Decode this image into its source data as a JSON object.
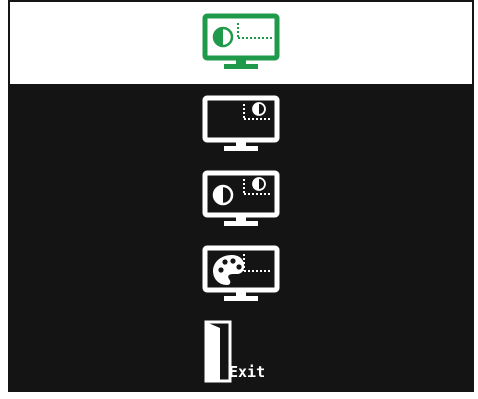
{
  "colors": {
    "frame_background": "#141414",
    "selected_background": "#ffffff",
    "selected_icon": "#1f9a4a",
    "icon": "#ffffff"
  },
  "menu": {
    "selected_index": 0,
    "items": [
      {
        "icon": "monitor-picture-in-picture-contrast-icon",
        "selected": true
      },
      {
        "icon": "monitor-sub-window-contrast-icon",
        "selected": false
      },
      {
        "icon": "monitor-dual-contrast-icon",
        "selected": false
      },
      {
        "icon": "monitor-color-palette-icon",
        "selected": false
      },
      {
        "icon": "exit-door-icon",
        "label": "Exit",
        "selected": false
      }
    ]
  },
  "footer": {
    "text": ""
  }
}
